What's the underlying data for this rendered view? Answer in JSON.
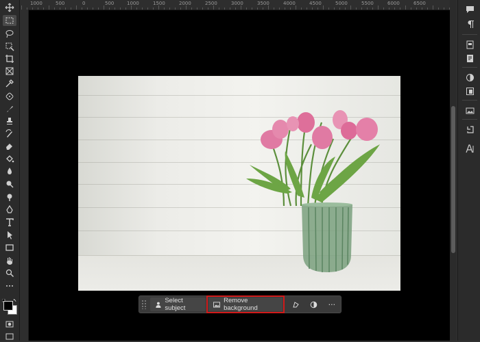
{
  "toolbar": {
    "tools": [
      "move",
      "marquee",
      "lasso",
      "object-select",
      "crop",
      "frame",
      "eyedropper",
      "spot-heal",
      "brush",
      "clone-stamp",
      "history-brush",
      "eraser",
      "paint-bucket",
      "blur",
      "dodge",
      "pen",
      "type",
      "path-select",
      "rectangle",
      "hand",
      "zoom",
      "more"
    ]
  },
  "rulers": {
    "horizontal_labels": [
      "1000",
      "500",
      "0",
      "500",
      "1000",
      "1500",
      "2000",
      "2500",
      "3000",
      "3500",
      "4000",
      "4500",
      "5000",
      "5500",
      "6000",
      "6500"
    ]
  },
  "taskbar": {
    "select_subject_label": "Select subject",
    "remove_background_label": "Remove background",
    "more_label": "···"
  },
  "colors": {
    "highlight": "#d21a1a",
    "app_bg": "#323232",
    "canvas_bg": "#000000"
  }
}
